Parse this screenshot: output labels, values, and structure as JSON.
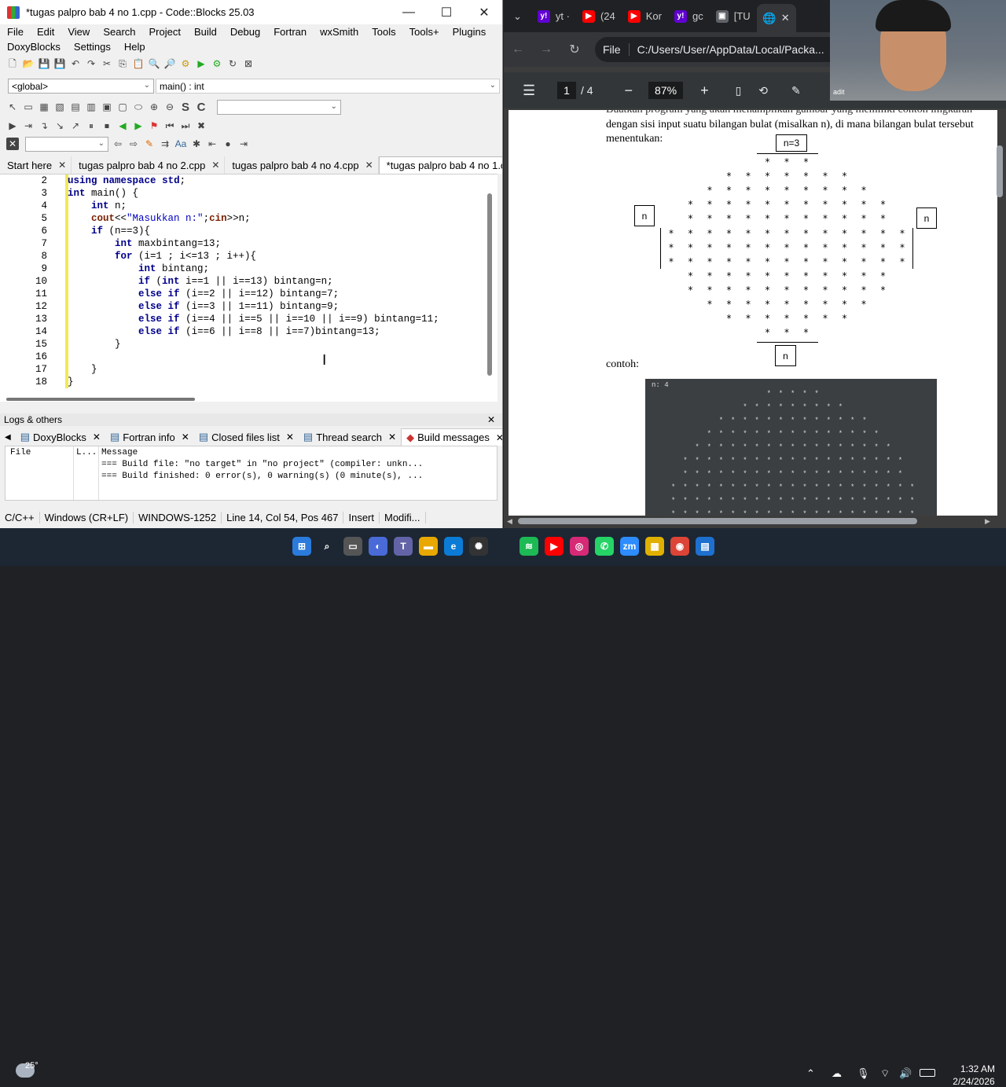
{
  "codeblocks": {
    "title": "*tugas palpro bab 4 no 1.cpp - Code::Blocks 25.03",
    "menu_row1": [
      "File",
      "Edit",
      "View",
      "Search",
      "Project",
      "Build",
      "Debug",
      "Fortran",
      "wxSmith",
      "Tools",
      "Tools+",
      "Plugins"
    ],
    "menu_row2": [
      "DoxyBlocks",
      "Settings",
      "Help"
    ],
    "scope_combo": "<global>",
    "function_combo": "main() : int",
    "tabs": [
      {
        "label": "Start here",
        "active": false
      },
      {
        "label": "tugas palpro bab 4 no 2.cpp",
        "active": false
      },
      {
        "label": "tugas palpro bab 4 no 4.cpp",
        "active": false
      },
      {
        "label": "*tugas palpro bab 4 no 1.cpp",
        "active": true
      }
    ],
    "code_lines": [
      {
        "n": "2",
        "text": "using namespace std;"
      },
      {
        "n": "3",
        "text": "int main() {"
      },
      {
        "n": "4",
        "text": "    int n;"
      },
      {
        "n": "5",
        "text": "    cout<<\"Masukkan n:\";cin>>n;"
      },
      {
        "n": "6",
        "text": "    if (n==3){"
      },
      {
        "n": "7",
        "text": "        int maxbintang=13;"
      },
      {
        "n": "8",
        "text": "        for (i=1 ; i<=13 ; i++){"
      },
      {
        "n": "9",
        "text": "            int bintang;"
      },
      {
        "n": "10",
        "text": "            if (int i==1 || i==13) bintang=n;"
      },
      {
        "n": "11",
        "text": "            else if (i==2 || i==12) bintang=7;"
      },
      {
        "n": "12",
        "text": "            else if (i==3 || 1==11) bintang=9;"
      },
      {
        "n": "13",
        "text": "            else if (i==4 || i==5 || i==10 || i==9) bintang=11;"
      },
      {
        "n": "14",
        "text": "            else if (i==6 || i==8 || i==7)bintang=13;"
      },
      {
        "n": "15",
        "text": "        }"
      },
      {
        "n": "16",
        "text": ""
      },
      {
        "n": "17",
        "text": "    }"
      },
      {
        "n": "18",
        "text": "}"
      }
    ],
    "logs_title": "Logs & others",
    "log_tabs": [
      {
        "label": "DoxyBlocks",
        "active": false
      },
      {
        "label": "Fortran info",
        "active": false
      },
      {
        "label": "Closed files list",
        "active": false
      },
      {
        "label": "Thread search",
        "active": false
      },
      {
        "label": "Build messages",
        "active": true
      }
    ],
    "log_headers": {
      "file": "File",
      "line": "L...",
      "message": "Message"
    },
    "log_messages": [
      "=== Build file: \"no target\" in \"no project\" (compiler: unkn...",
      "=== Build finished: 0 error(s), 0 warning(s) (0 minute(s), ..."
    ],
    "status": [
      "C/C++",
      "Windows (CR+LF)",
      "WINDOWS-1252",
      "Line 14, Col 54, Pos 467",
      "Insert",
      "Modifi..."
    ]
  },
  "browser": {
    "tabs": [
      {
        "icon": "y!",
        "label": "yt ·",
        "color": "#6001d2"
      },
      {
        "icon": "▶",
        "label": "(24",
        "color": "#ff0000"
      },
      {
        "icon": "▶",
        "label": "Kor",
        "color": "#ff0000"
      },
      {
        "icon": "y!",
        "label": "gc",
        "color": "#6001d2"
      },
      {
        "icon": "▣",
        "label": "[TU",
        "color": "#5f6368"
      }
    ],
    "address_chip": "File",
    "address": "C:/Users/User/AppData/Local/Packa...",
    "pdf_page": "1",
    "pdf_pages": "/ 4",
    "zoom": "87%",
    "doc_line1": "Buatkan program yang akan menampilkan gambar yang memiliki contoh imgkaran",
    "doc_line2": "dengan sisi input suatu bilangan bulat (misalkan n), di mana bilangan bulat tersebut",
    "doc_line3": "menentukan:",
    "label_n3": "n=3",
    "label_n": "n",
    "contoh": "contoh:",
    "term_prompt": "n: 4",
    "webcam_label": "adit"
  },
  "taskbar": {
    "weather": "25°",
    "time": "1:32 AM",
    "date": "2/24/2026"
  }
}
